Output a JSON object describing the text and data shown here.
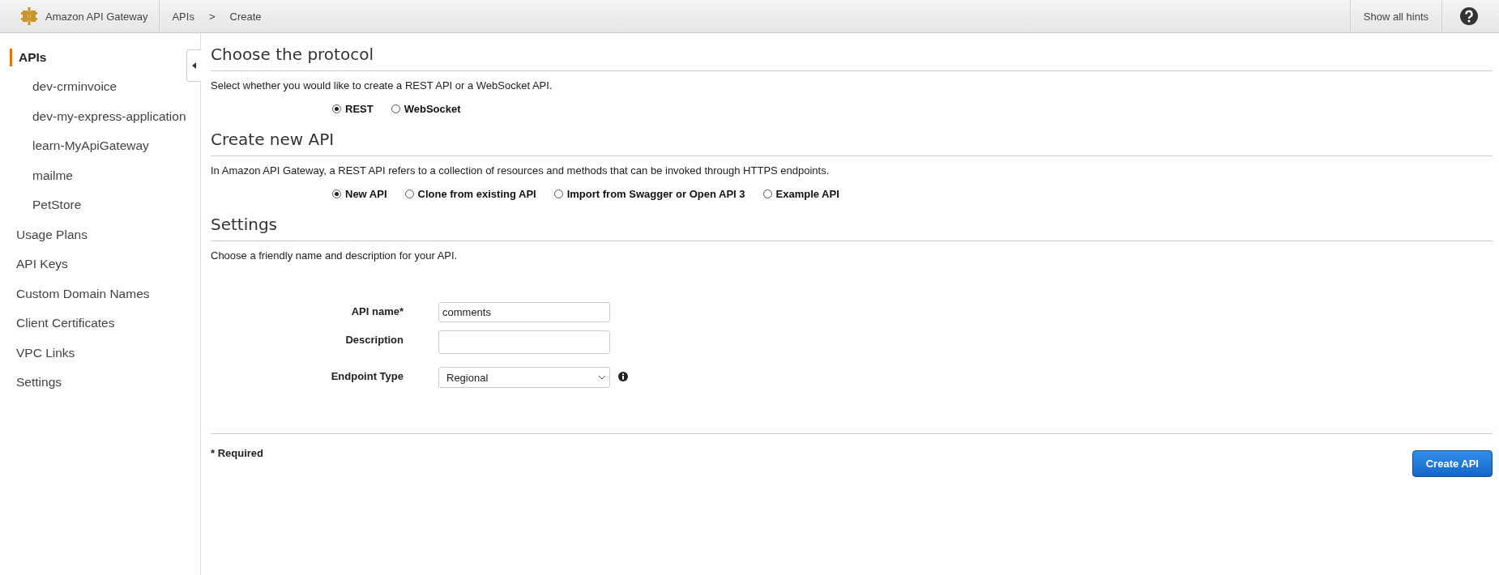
{
  "topbar": {
    "service": "Amazon API Gateway",
    "breadcrumbs": [
      "APIs",
      ">",
      "Create"
    ],
    "hints": "Show all hints"
  },
  "sidebar": {
    "items": [
      {
        "label": "APIs",
        "selected": true,
        "children": [
          {
            "label": "dev-crminvoice",
            "selected": false
          },
          {
            "label": "dev-my-express-application",
            "selected": false
          },
          {
            "label": "learn-MyApiGateway",
            "selected": false
          },
          {
            "label": "mailme",
            "selected": false
          },
          {
            "label": "PetStore",
            "selected": false
          }
        ]
      },
      {
        "label": "Usage Plans",
        "selected": false
      },
      {
        "label": "API Keys",
        "selected": false
      },
      {
        "label": "Custom Domain Names",
        "selected": false
      },
      {
        "label": "Client Certificates",
        "selected": false
      },
      {
        "label": "VPC Links",
        "selected": false
      },
      {
        "label": "Settings",
        "selected": false
      }
    ]
  },
  "sections": [
    {
      "title": "Choose the protocol",
      "description": "Select whether you would like to create a REST API or a WebSocket API.",
      "options": [
        {
          "label": "REST",
          "selected": true
        },
        {
          "label": "WebSocket",
          "selected": false
        }
      ]
    },
    {
      "title": "Create new API",
      "description": "In Amazon API Gateway, a REST API refers to a collection of resources and methods that can be invoked through HTTPS endpoints.",
      "options": [
        {
          "label": "New API",
          "selected": true
        },
        {
          "label": "Clone from existing API",
          "selected": false
        },
        {
          "label": "Import from Swagger or Open API 3",
          "selected": false
        },
        {
          "label": "Example API",
          "selected": false
        }
      ]
    },
    {
      "title": "Settings",
      "description": "Choose a friendly name and description for your API."
    }
  ],
  "form": [
    {
      "kind": "text",
      "label": "API name*",
      "value": "comments"
    },
    {
      "kind": "text",
      "label": "Description"
    },
    {
      "kind": "select",
      "label": "Endpoint Type",
      "value": "Regional"
    }
  ],
  "required_note": "* Required",
  "submit": "Create API"
}
